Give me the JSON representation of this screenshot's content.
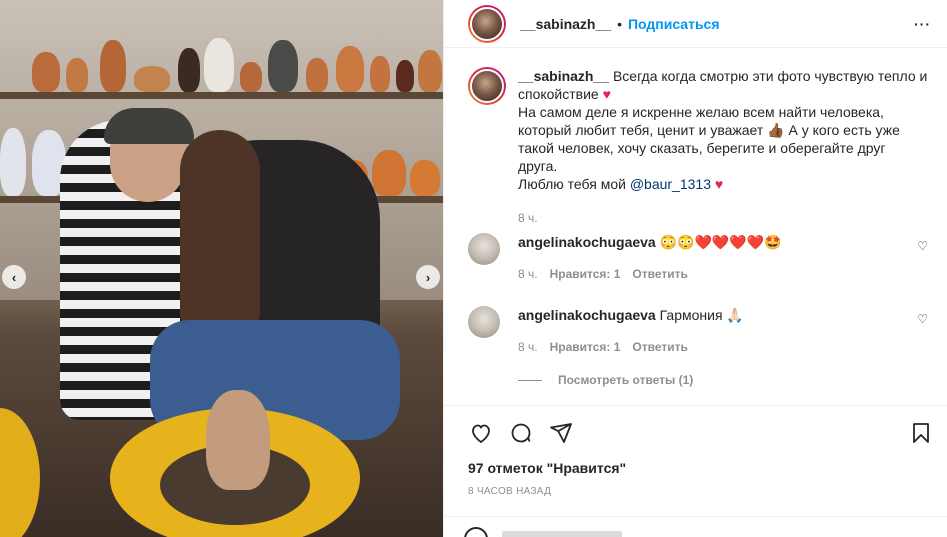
{
  "header": {
    "username": "__sabinazh__",
    "separator": "•",
    "follow_label": "Подписаться",
    "more_label": "···"
  },
  "caption": {
    "username": "__sabinazh__",
    "text1": "Всегда когда смотрю эти фото чувствую тепло и спокойствие",
    "heart1": "♥",
    "text2": "На самом деле я искренне желаю всем найти человека, который любит тебя, ценит и уважает",
    "emoji_hand": "👍🏾",
    "text3": "А у кого есть уже такой человек, хочу сказать, берегите и оберегайте друг друга.",
    "text4": "Люблю тебя мой",
    "mention": "@baur_1313",
    "heart2": "♥",
    "time": "8 ч."
  },
  "comments": [
    {
      "username": "angelinakochugaeva",
      "text": "",
      "emojis": "😳😳❤️❤️❤️❤️🤩",
      "time": "8 ч.",
      "likes": "Нравится: 1",
      "reply": "Ответить"
    },
    {
      "username": "angelinakochugaeva",
      "text": "Гармония",
      "emojis": "🙏🏻",
      "time": "8 ч.",
      "likes": "Нравится: 1",
      "reply": "Ответить"
    }
  ],
  "view_replies": "Посмотреть ответы (1)",
  "likes": "97 отметок \"Нравится\"",
  "time_ago": "8 ЧАСОВ НАЗАД",
  "icons": {
    "like": "heart-icon",
    "comment": "comment-icon",
    "share": "share-icon",
    "save": "bookmark-icon",
    "prev": "chevron-left-icon",
    "next": "chevron-right-icon"
  },
  "nav": {
    "prev": "‹",
    "next": "›"
  },
  "colors": {
    "accent": "#0095f6",
    "heart": "#e0245e",
    "muted": "#8e8e8e",
    "text": "#262626"
  }
}
